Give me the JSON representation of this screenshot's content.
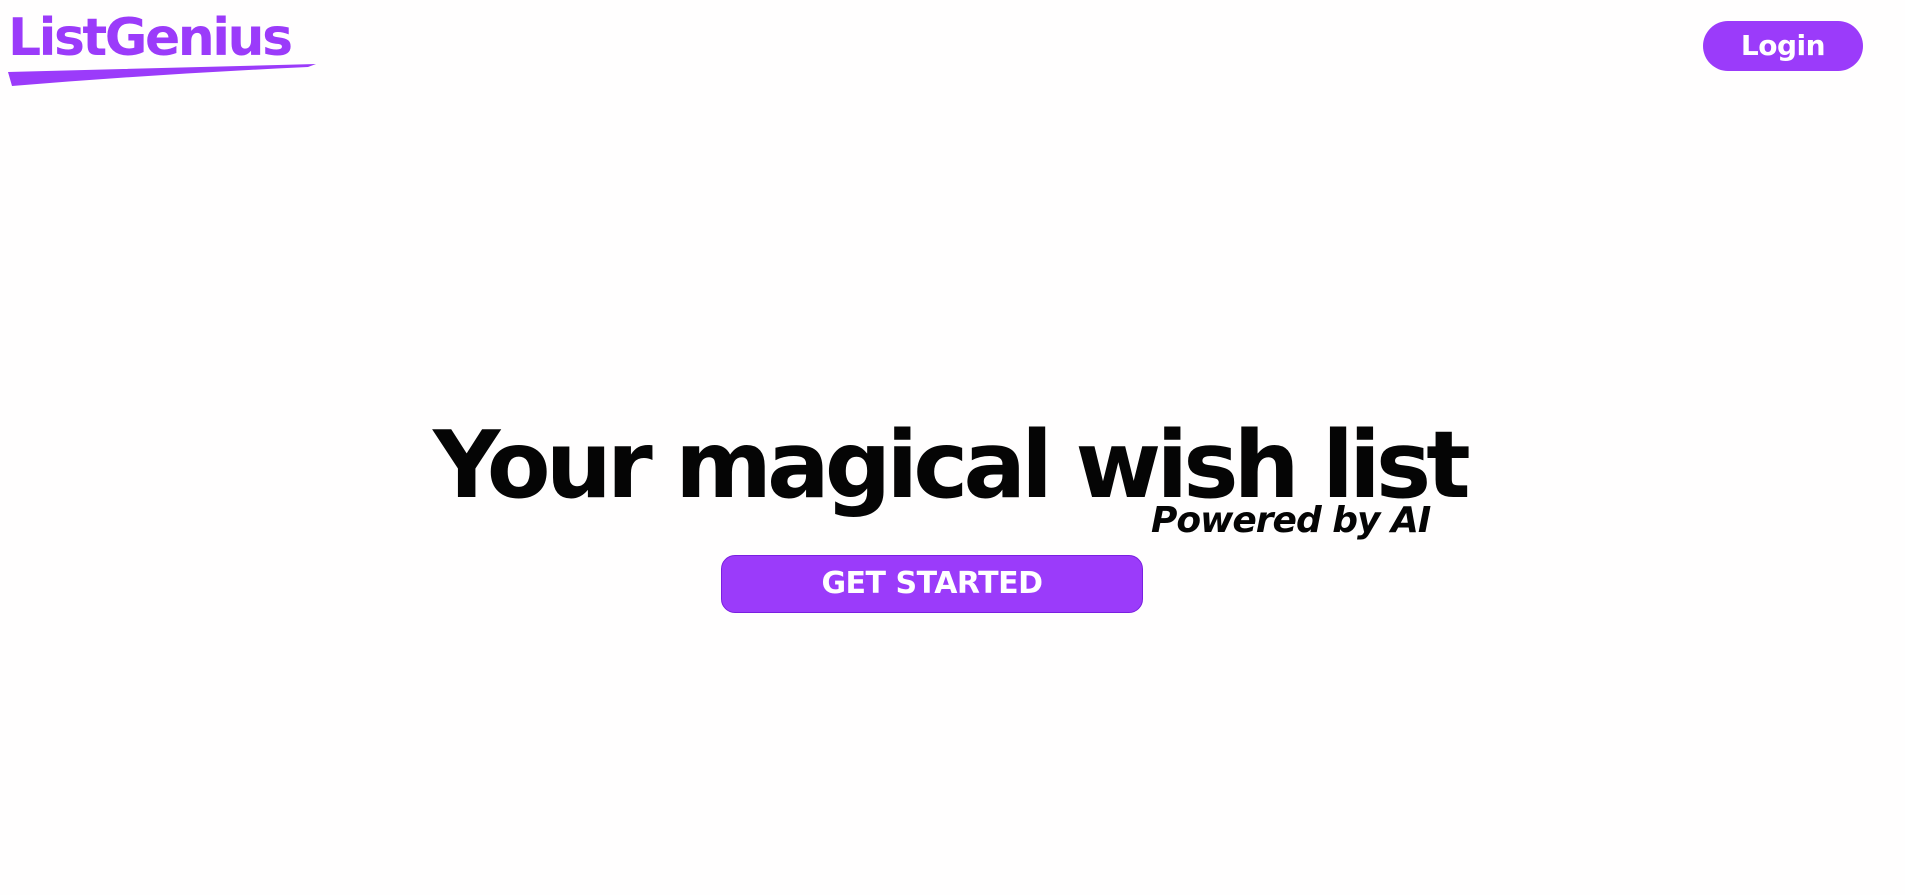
{
  "header": {
    "logo_text": "ListGenius",
    "login_label": "Login"
  },
  "hero": {
    "headline": "Your magical wish list",
    "tagline": "Powered by AI",
    "cta_label": "GET STARTED"
  },
  "colors": {
    "brand": "#9b3bfa",
    "text": "#050505",
    "background": "#fffefe",
    "button_text": "#ffffff"
  }
}
